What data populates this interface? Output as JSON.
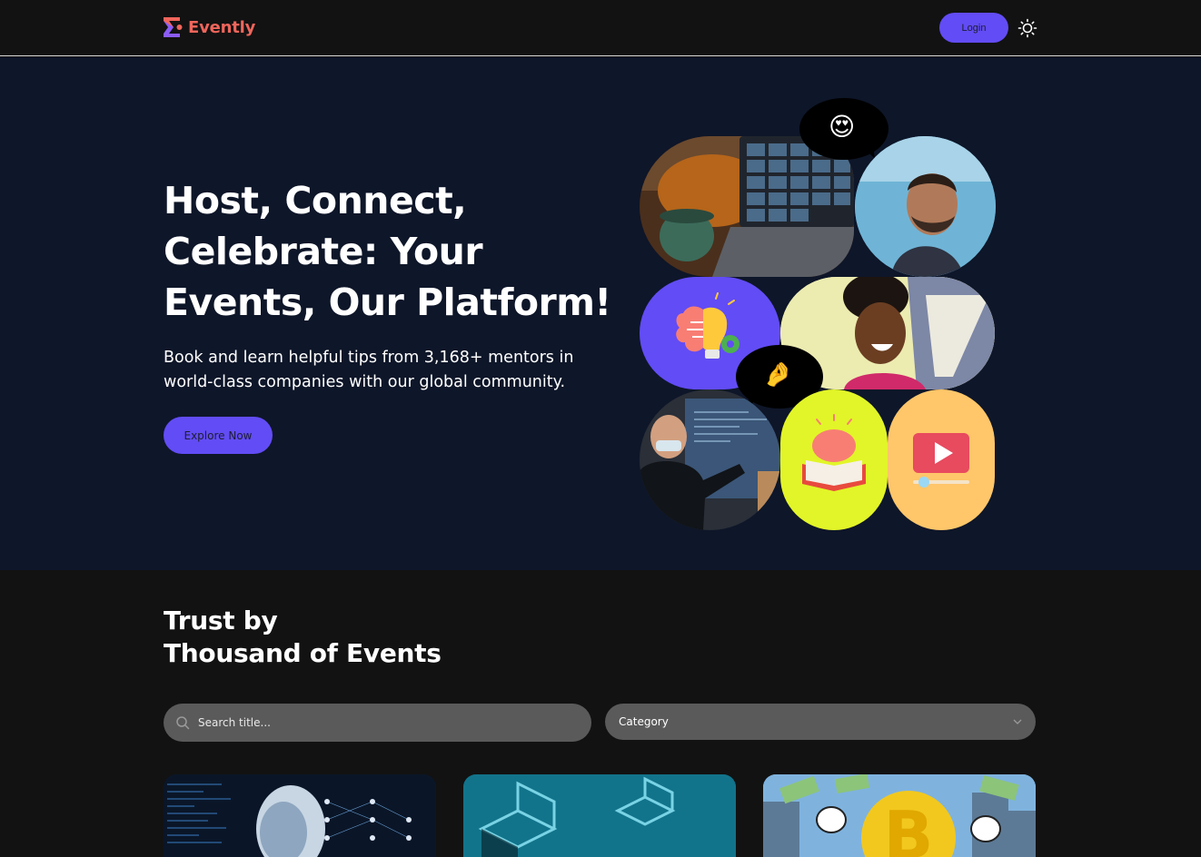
{
  "header": {
    "brand": "Evently",
    "login_label": "Login",
    "colors": {
      "brand": "#f0655b",
      "accent": "#624cf5"
    }
  },
  "hero": {
    "title_line1": "Host, Connect,",
    "title_line2": "Celebrate: Your",
    "title_line3": "Events, Our Platform!",
    "subtitle_line1": "Book and learn helpful tips from 3,168+ mentors in",
    "subtitle_line2": "world-class companies with our global community.",
    "cta_label": "Explore Now",
    "emojis": {
      "heart_eyes": "😍",
      "pinch": "🤌"
    }
  },
  "trust": {
    "title_line1": "Trust by",
    "title_line2": "Thousand of Events"
  },
  "filters": {
    "search_placeholder": "Search title...",
    "category_label": "Category"
  },
  "events": [
    {
      "image": "ai-neural-network-image"
    },
    {
      "image": "blockchain-cubes-image"
    },
    {
      "image": "bitcoin-cartoon-image"
    }
  ]
}
